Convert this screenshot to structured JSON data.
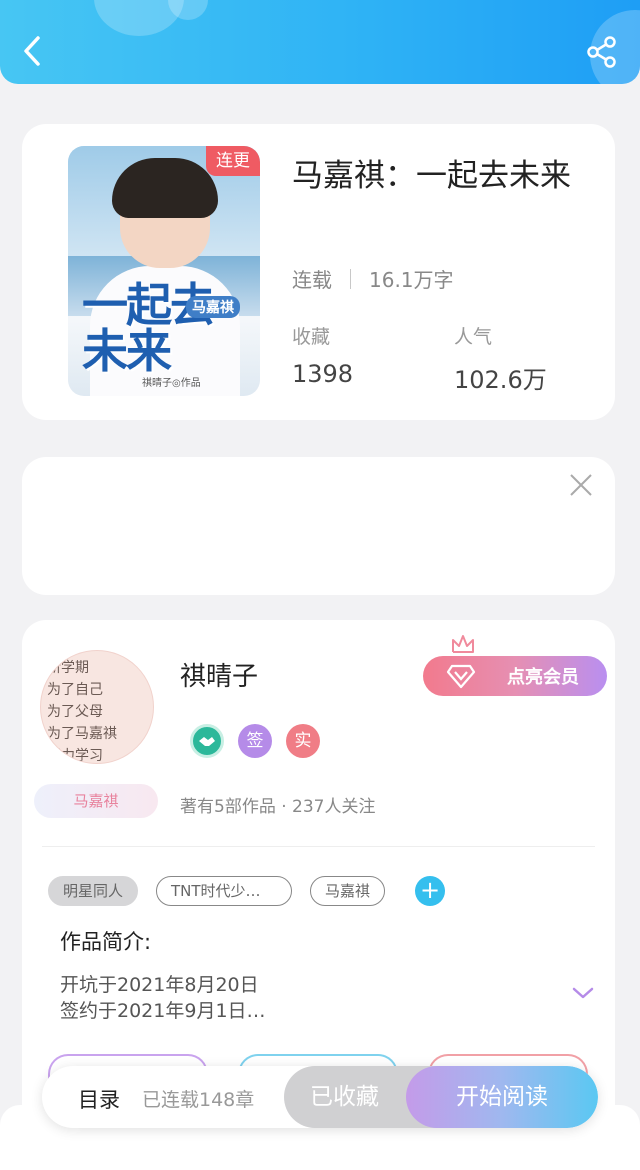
{
  "header": {
    "back_icon": "back-arrow-icon",
    "share_icon": "share-icon"
  },
  "book": {
    "title": "马嘉祺：一起去未来",
    "status_badge": "连更",
    "status": "连载",
    "word_count": "16.1万字",
    "favorites_label": "收藏",
    "favorites_value": "1398",
    "popularity_label": "人气",
    "popularity_value": "102.6万",
    "cover": {
      "title_text": "一起去未来",
      "name_tag": "马嘉祺",
      "author_text": "祺晴子◎作品"
    }
  },
  "ad": {
    "close_icon": "close-icon"
  },
  "author": {
    "name": "祺晴子",
    "avatar_lines": [
      "新学期",
      "为了自己",
      "为了父母",
      "为了马嘉祺",
      "努力学习"
    ],
    "vip_button": "点亮会员",
    "badges": [
      {
        "icon": "handshake-badge-icon",
        "text": "",
        "color": "#2cb89a"
      },
      {
        "icon": "signed-badge-icon",
        "text": "签",
        "color": "#b58be8"
      },
      {
        "icon": "verified-badge-icon",
        "text": "实",
        "color": "#f07d86"
      }
    ],
    "tag": "马嘉祺",
    "stats": "著有5部作品 · 237人关注"
  },
  "tags": [
    "明星同人",
    "TNT时代少…",
    "马嘉祺"
  ],
  "intro": {
    "title": "作品简介:",
    "line1": "开坑于2021年8月20日",
    "line2": "签约于2021年9月1日…"
  },
  "bottom_bar": {
    "catalog": "目录",
    "chapters": "已连载148章",
    "collected": "已收藏",
    "start_reading": "开始阅读"
  },
  "colors": {
    "header_start": "#47c6f3",
    "header_end": "#1e9ef5",
    "badge_red": "#ef5b63",
    "accent_blue": "#35bfee"
  }
}
